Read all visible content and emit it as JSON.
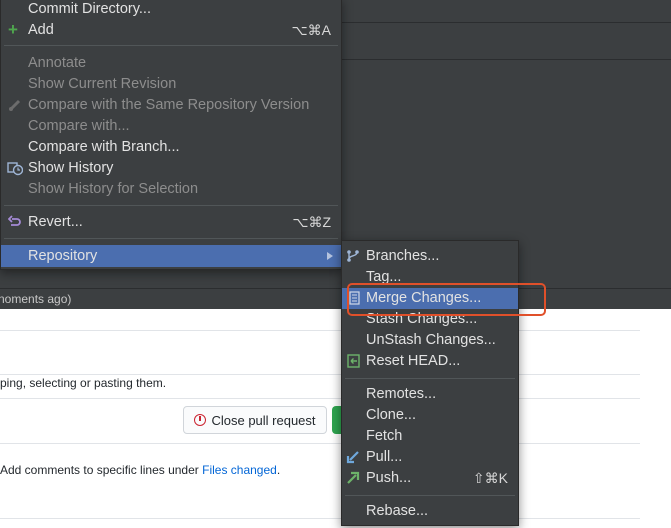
{
  "status_bar": {
    "text": "noments ago)"
  },
  "github": {
    "hint_text": "ping, selecting or pasting them.",
    "close_pr_label": "Close pull request",
    "comment_prefix": "Add comments to specific lines under ",
    "comment_link": "Files changed",
    "comment_suffix": "."
  },
  "main_menu": {
    "items": [
      {
        "label": "Commit Directory...",
        "enabled": true
      },
      {
        "label": "Add",
        "shortcut": "⌥⌘A",
        "icon": "plus-icon",
        "enabled": true
      },
      {
        "label": "Annotate",
        "enabled": false
      },
      {
        "label": "Show Current Revision",
        "enabled": false
      },
      {
        "label": "Compare with the Same Repository Version",
        "icon": "diff-icon",
        "enabled": false
      },
      {
        "label": "Compare with...",
        "enabled": false
      },
      {
        "label": "Compare with Branch...",
        "enabled": true
      },
      {
        "label": "Show History",
        "icon": "history-icon",
        "enabled": true
      },
      {
        "label": "Show History for Selection",
        "enabled": false
      },
      {
        "label": "Revert...",
        "shortcut": "⌥⌘Z",
        "icon": "revert-icon",
        "enabled": true
      },
      {
        "label": "Repository",
        "enabled": true,
        "selected": true
      }
    ]
  },
  "repository_menu": {
    "items": [
      {
        "label": "Branches...",
        "icon": "branch-icon"
      },
      {
        "label": "Tag..."
      },
      {
        "label": "Merge Changes...",
        "icon": "merge-icon",
        "selected": true
      },
      {
        "label": "Stash Changes..."
      },
      {
        "label": "UnStash Changes..."
      },
      {
        "label": "Reset HEAD...",
        "icon": "reset-icon"
      },
      {
        "label": "Remotes..."
      },
      {
        "label": "Clone..."
      },
      {
        "label": "Fetch"
      },
      {
        "label": "Pull...",
        "icon": "pull-icon"
      },
      {
        "label": "Push...",
        "shortcut": "⇧⌘K",
        "icon": "push-icon"
      },
      {
        "label": "Rebase..."
      }
    ]
  },
  "colors": {
    "menu_bg": "#3c3f41",
    "selection": "#4b6eaf",
    "callout": "#e0502a"
  }
}
